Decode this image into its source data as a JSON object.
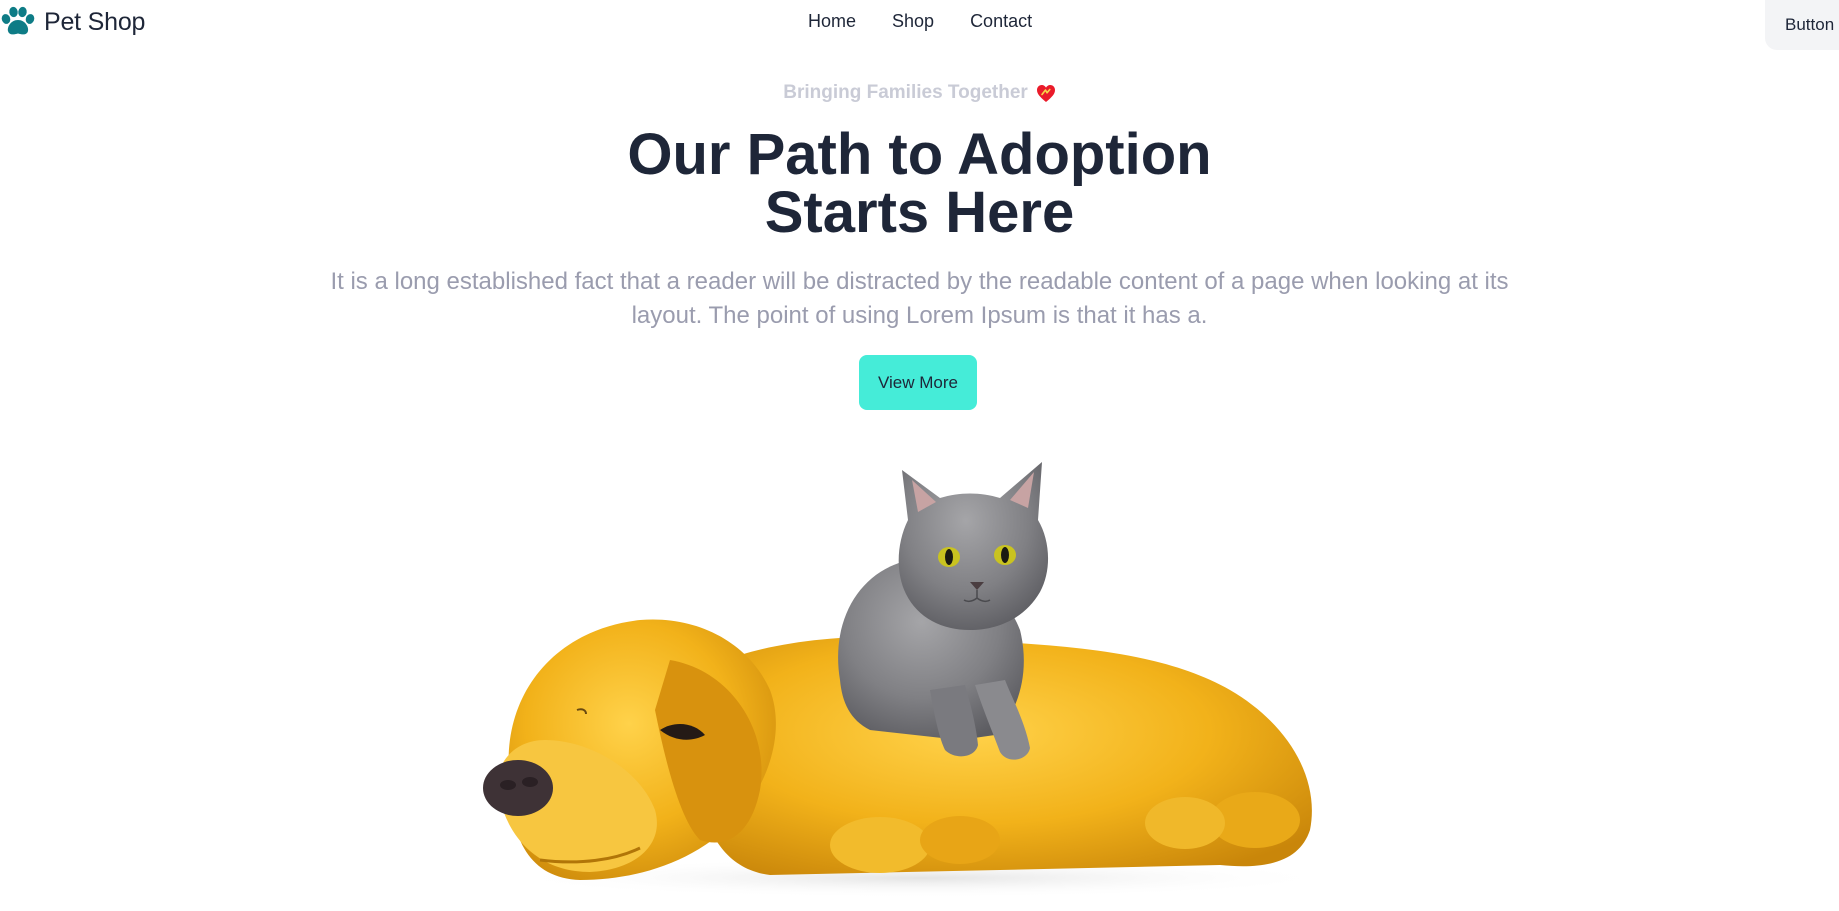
{
  "nav": {
    "brand": {
      "name": "Pet Shop",
      "icon": "paw-icon",
      "icon_color": "#0e7c86"
    },
    "links": [
      {
        "label": "Home"
      },
      {
        "label": "Shop"
      },
      {
        "label": "Contact"
      }
    ],
    "button_label": "Button"
  },
  "hero": {
    "tagline": "Bringing Families Together",
    "tagline_icon": "heart-icon",
    "headline_line1": "Our Path to Adoption",
    "headline_line2": "Starts Here",
    "lead": "It is a long established fact that a reader will be distracted by the readable content of a page when looking at its layout. The point of using Lorem Ipsum is that it has a.",
    "cta_label": "View More",
    "image": "golden-retriever-with-gray-kitten"
  },
  "colors": {
    "text": "#1e2638",
    "tagline": "#c9cbd6",
    "lead": "#9a9cae",
    "cta_bg": "#45ecd8",
    "nav_button_bg": "#f3f4f6"
  }
}
